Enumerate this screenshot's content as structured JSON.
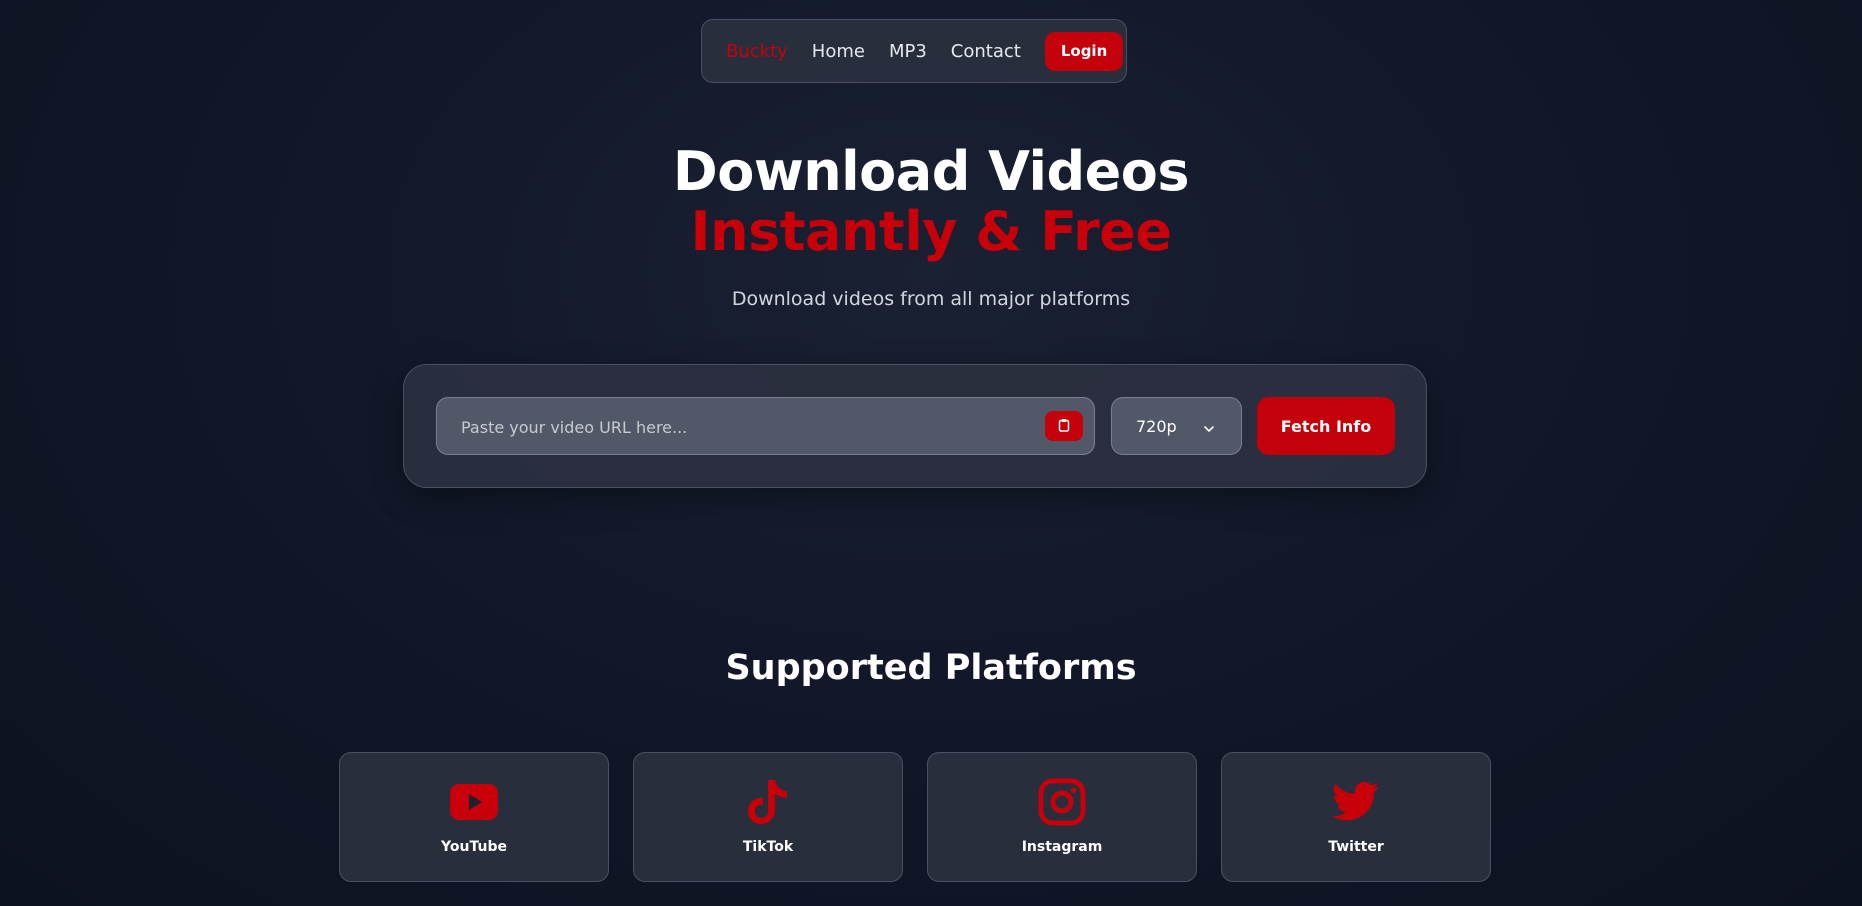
{
  "nav": {
    "brand": "Buckty",
    "links": [
      "Home",
      "MP3",
      "Contact"
    ],
    "login_label": "Login"
  },
  "hero": {
    "title_line1": "Download Videos",
    "title_line2": "Instantly & Free",
    "subtitle": "Download videos from all major platforms"
  },
  "download": {
    "url_placeholder": "Paste your video URL here...",
    "paste_icon": "clipboard-icon",
    "quality": "720p",
    "quality_icon": "chevron-down-icon",
    "fetch_label": "Fetch Info"
  },
  "platforms": {
    "title": "Supported Platforms",
    "items": [
      {
        "label": "YouTube",
        "icon": "youtube-icon"
      },
      {
        "label": "TikTok",
        "icon": "tiktok-icon"
      },
      {
        "label": "Instagram",
        "icon": "instagram-icon"
      },
      {
        "label": "Twitter",
        "icon": "twitter-icon"
      }
    ]
  },
  "colors": {
    "accent": "#c4000a",
    "background": "#121829",
    "panel": "#2c3140"
  }
}
